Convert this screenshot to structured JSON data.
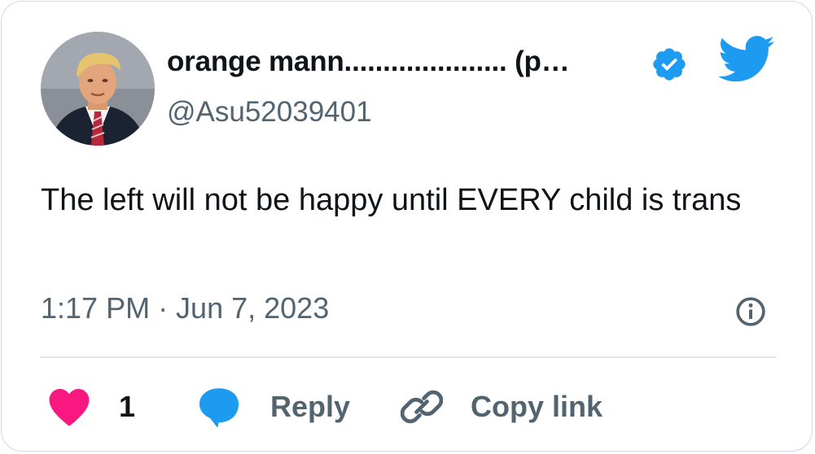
{
  "tweet": {
    "display_name": "orange mann..................... (p…",
    "handle": "@Asu52039401",
    "text": "The left will not be happy until EVERY child is trans",
    "timestamp": "1:17 PM · Jun 7, 2023"
  },
  "actions": {
    "like_count": "1",
    "reply_label": "Reply",
    "copy_link_label": "Copy link"
  },
  "icons": {
    "verified": "verified-badge-icon",
    "brand": "twitter-bird-icon",
    "info": "info-icon",
    "like": "heart-icon",
    "reply": "speech-bubble-icon",
    "copy": "link-icon"
  },
  "colors": {
    "brand_blue": "#1d9bf0",
    "like_pink": "#f91880",
    "text_primary": "#0f1419",
    "text_secondary": "#536471",
    "border": "#cfd9de"
  }
}
